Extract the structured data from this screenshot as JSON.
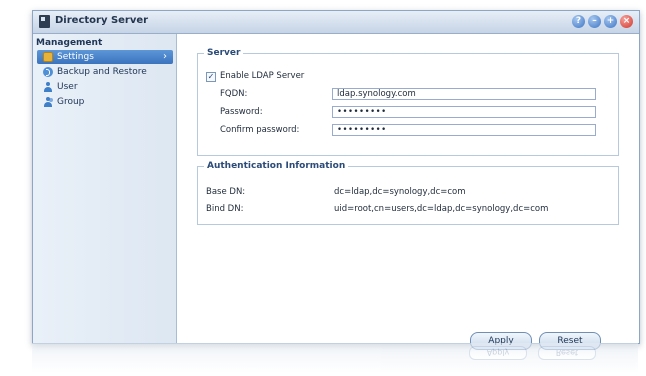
{
  "window": {
    "title": "Directory Server"
  },
  "title_buttons": [
    "help-icon",
    "minimize-icon",
    "maximize-icon",
    "close-icon"
  ],
  "sidebar": {
    "header": "Management",
    "items": [
      {
        "label": "Settings",
        "icon": "settings-icon",
        "selected": true
      },
      {
        "label": "Backup and Restore",
        "icon": "backup-restore-icon",
        "selected": false
      },
      {
        "label": "User",
        "icon": "user-icon",
        "selected": false
      },
      {
        "label": "Group",
        "icon": "group-icon",
        "selected": false
      }
    ]
  },
  "server": {
    "legend": "Server",
    "enable_ldap": {
      "label": "Enable LDAP Server",
      "checked": true,
      "mark": "✓"
    },
    "fqdn": {
      "label": "FQDN:",
      "value": "ldap.synology.com"
    },
    "password": {
      "label": "Password:",
      "value": "•••••••••"
    },
    "confirm_password": {
      "label": "Confirm password:",
      "value": "•••••••••"
    }
  },
  "auth": {
    "legend": "Authentication Information",
    "base_dn": {
      "label": "Base DN:",
      "value": "dc=ldap,dc=synology,dc=com"
    },
    "bind_dn": {
      "label": "Bind DN:",
      "value": "uid=root,cn=users,dc=ldap,dc=synology,dc=com"
    }
  },
  "buttons": {
    "apply": "Apply",
    "reset": "Reset"
  },
  "colors": {
    "accent": "#3b73bd",
    "border": "#b7c9de",
    "close": "#d0382b"
  }
}
